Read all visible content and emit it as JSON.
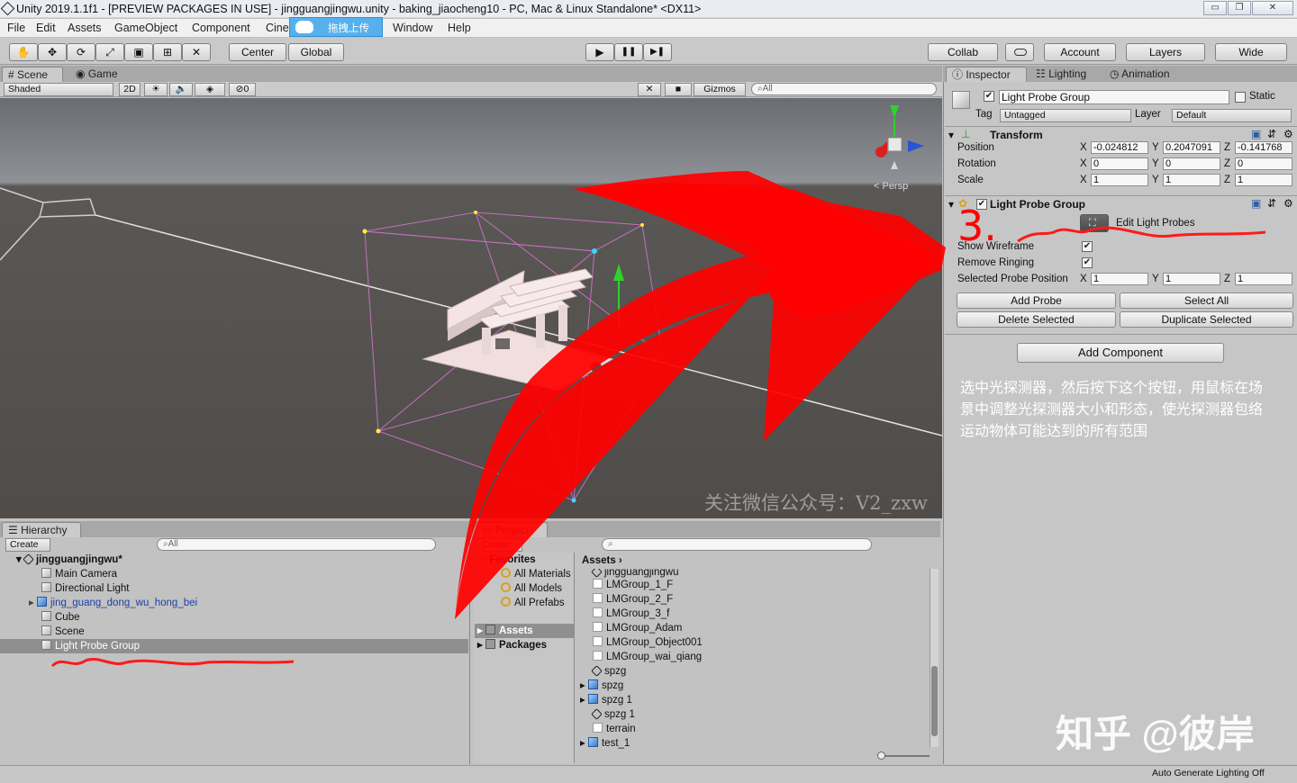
{
  "window": {
    "title": "Unity 2019.1.1f1 - [PREVIEW PACKAGES IN USE] - jingguangjingwu.unity - baking_jiaocheng10 - PC, Mac & Linux Standalone* <DX11>",
    "controls": [
      "▭",
      "❐",
      "✕"
    ]
  },
  "menu": [
    "File",
    "Edit",
    "Assets",
    "GameObject",
    "Component",
    "Cine",
    "Window",
    "Help"
  ],
  "upload_badge": "拖拽上传",
  "toolbar": {
    "tools": [
      "✋",
      "✥",
      "⟳",
      "⤢",
      "▣",
      "⊞",
      "✕"
    ],
    "pivot": "Center",
    "space": "Global",
    "play": "▶",
    "pause": "❚❚",
    "step": "▶❚",
    "collab": "Collab",
    "account": "Account",
    "layers": "Layers",
    "layout": "Wide"
  },
  "scene": {
    "tabs": [
      "Scene",
      "Game"
    ],
    "shading": "Shaded",
    "mode2d": "2D",
    "hidden_count": "0",
    "gizmos": "Gizmos",
    "search": "All",
    "persp": "< Persp",
    "watermark": "关注微信公众号：V2_zxw"
  },
  "hierarchy": {
    "tab": "Hierarchy",
    "create": "Create",
    "search": "All",
    "scene_name": "jingguangjingwu*",
    "items": [
      "Main Camera",
      "Directional Light",
      "jing_guang_dong_wu_hong_bei",
      "Cube",
      "Scene",
      "Light Probe Group"
    ]
  },
  "project": {
    "tab": "Project",
    "create": "Create",
    "favorites": "Favorites",
    "fav_items": [
      "All Materials",
      "All Models",
      "All Prefabs"
    ],
    "roots": [
      "Assets",
      "Packages"
    ],
    "breadcrumb": "Assets",
    "assets": [
      "jingguangjingwu",
      "LMGroup_1_F",
      "LMGroup_2_F",
      "LMGroup_3_f",
      "LMGroup_Adam",
      "LMGroup_Object001",
      "LMGroup_wai_qiang",
      "spzg",
      "spzg",
      "spzg 1",
      "spzg 1",
      "terrain",
      "test_1"
    ]
  },
  "inspector": {
    "tabs": [
      "Inspector",
      "Lighting",
      "Animation"
    ],
    "object_name": "Light Probe Group",
    "static_label": "Static",
    "tag_label": "Tag",
    "tag_value": "Untagged",
    "layer_label": "Layer",
    "layer_value": "Default",
    "transform": {
      "title": "Transform",
      "position_label": "Position",
      "rotation_label": "Rotation",
      "scale_label": "Scale",
      "position": [
        "-0.024812",
        "0.2047091",
        "-0.141768"
      ],
      "rotation": [
        "0",
        "0",
        "0"
      ],
      "scale": [
        "1",
        "1",
        "1"
      ],
      "axes": [
        "X",
        "Y",
        "Z"
      ]
    },
    "lpg": {
      "title": "Light Probe Group",
      "edit_label": "Edit Light Probes",
      "show_wireframe": "Show Wireframe",
      "remove_ringing": "Remove Ringing",
      "selected_probe_position": "Selected Probe Position",
      "sel_values": [
        "1",
        "1",
        "1"
      ],
      "add_probe": "Add Probe",
      "select_all": "Select All",
      "delete_selected": "Delete Selected",
      "duplicate_selected": "Duplicate Selected"
    },
    "add_component": "Add Component"
  },
  "annotations": {
    "step_number": "3.",
    "note": "选中光探测器，然后按下这个按钮，用鼠标在场景中调整光探测器大小和形态，使光探测器包络运动物体可能达到的所有范围",
    "credit": "知乎 @彼岸"
  },
  "status": {
    "text": "Auto Generate Lighting Off"
  },
  "colors": {
    "arrow": "#ff0000",
    "accent_blue": "#56b0ee",
    "selection": "#8f8f8f"
  }
}
